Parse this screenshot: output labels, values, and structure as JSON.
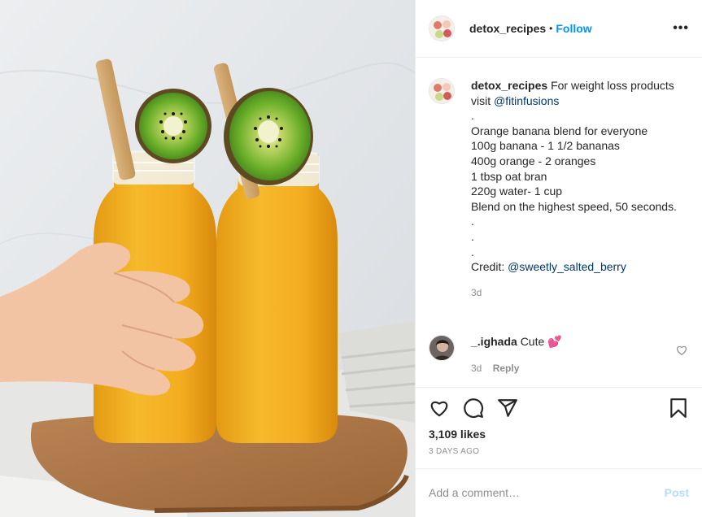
{
  "post": {
    "username": "detox_recipes",
    "follow_label": "Follow",
    "header_dot": "•",
    "more_label": "•••",
    "caption": {
      "username": "detox_recipes",
      "intro": "For weight loss products visit ",
      "intro_mention": "@fitinfusions",
      "lines": [
        ".",
        "Orange banana blend for everyone",
        "100g banana - 1 1/2 bananas",
        "400g orange - 2 oranges",
        "1 tbsp oat bran",
        "220g water- 1 cup",
        "Blend on the highest speed, 50 seconds.",
        ".",
        ".",
        "."
      ],
      "credit_label": "Credit: ",
      "credit_mention": "@sweetly_salted_berry",
      "time": "3d"
    },
    "comment": {
      "username": "_.ighada",
      "text": "Cute 💕",
      "time": "3d",
      "reply_label": "Reply"
    },
    "likes": "3,109 likes",
    "posted_ago": "3 DAYS AGO",
    "add_comment_placeholder": "Add a comment…",
    "post_button": "Post",
    "icons": [
      "heart-icon",
      "comment-icon",
      "share-icon",
      "bookmark-icon",
      "more-icon",
      "small-heart-icon"
    ],
    "colors": {
      "link": "#0095f6",
      "mention": "#00376b",
      "muted": "#8e8e8e",
      "post_disabled": "#b2dffc"
    }
  }
}
